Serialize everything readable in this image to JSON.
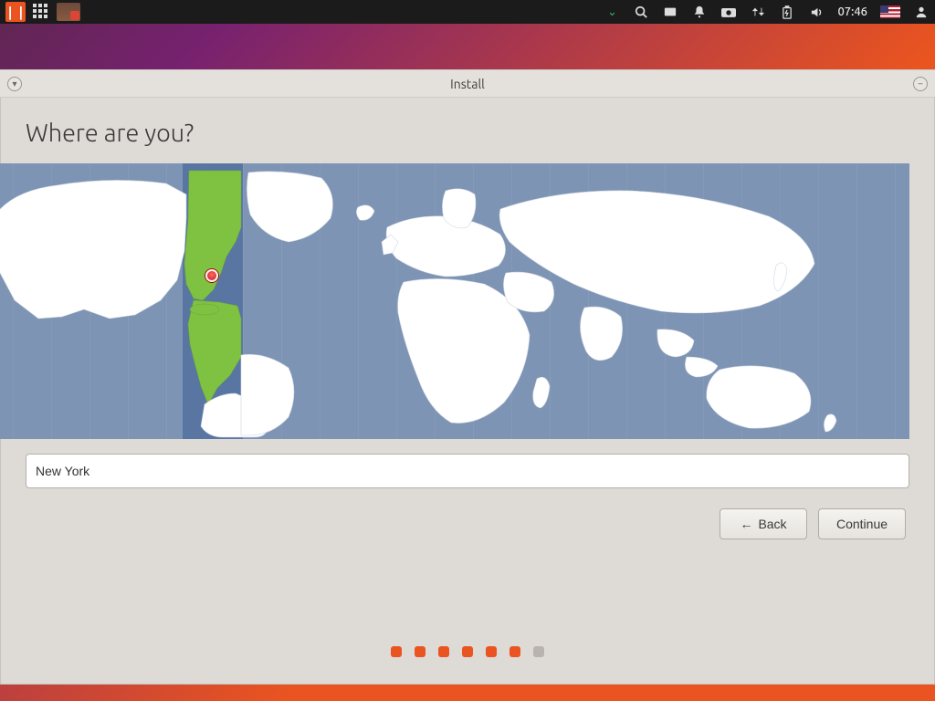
{
  "topbar": {
    "clock": "07:46",
    "locale": "US"
  },
  "window": {
    "title": "Install"
  },
  "page": {
    "heading": "Where are you?"
  },
  "timezone": {
    "value": "New York"
  },
  "nav": {
    "back_label": "Back",
    "continue_label": "Continue"
  },
  "progress": {
    "total": 7,
    "completed": 6
  }
}
